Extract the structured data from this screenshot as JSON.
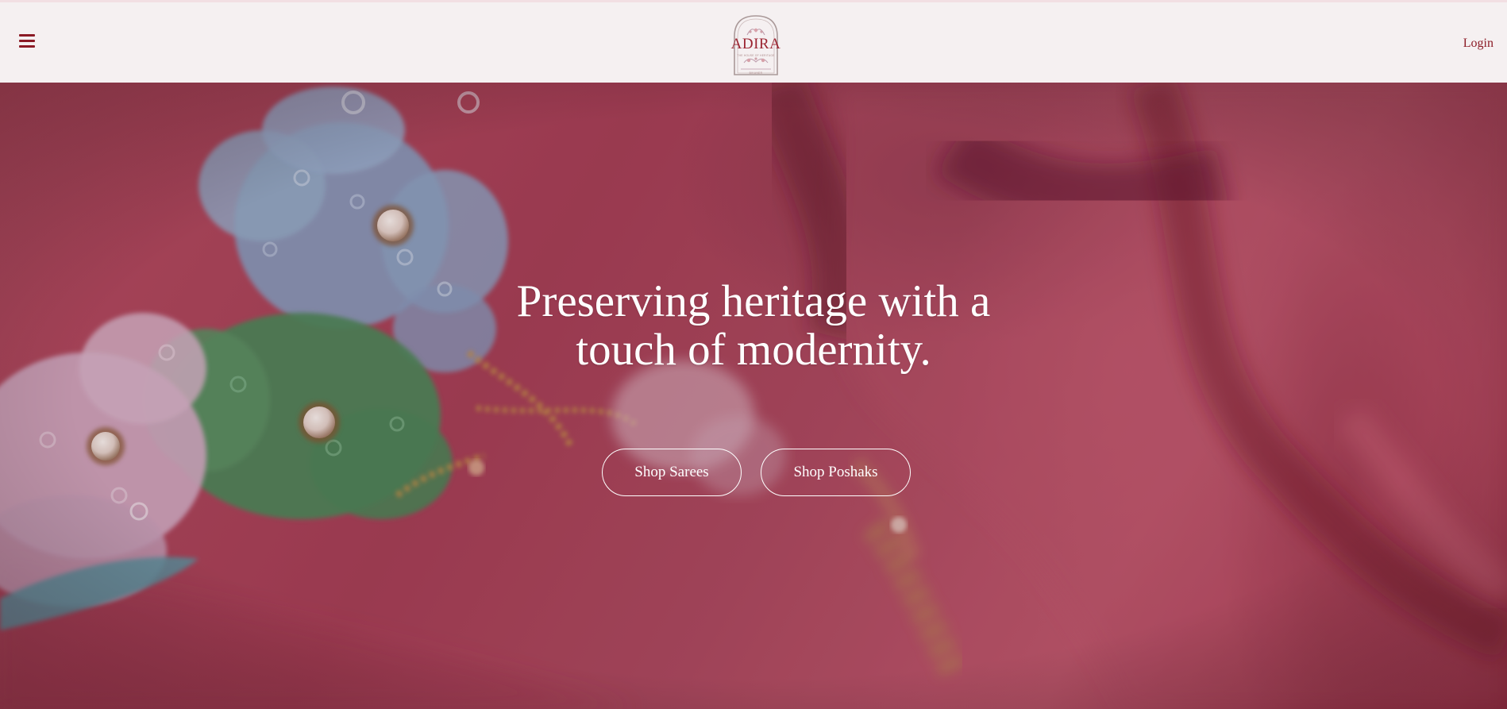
{
  "header": {
    "menu_icon": "hamburger-menu-icon",
    "logo": {
      "name": "ADIRA",
      "tagline": "THE HOUSE OF HERITAGE",
      "sub": "BIKANER"
    },
    "login_label": "Login"
  },
  "hero": {
    "headline": "Preserving heritage with a touch of modernity.",
    "buttons": [
      {
        "label": "Shop Sarees"
      },
      {
        "label": "Shop Poshaks"
      }
    ]
  },
  "colors": {
    "brand": "#8b1a25",
    "header_bg": "#f5f0f1",
    "hero_fabric": "#b04d62",
    "text_on_hero": "#ffffff"
  }
}
